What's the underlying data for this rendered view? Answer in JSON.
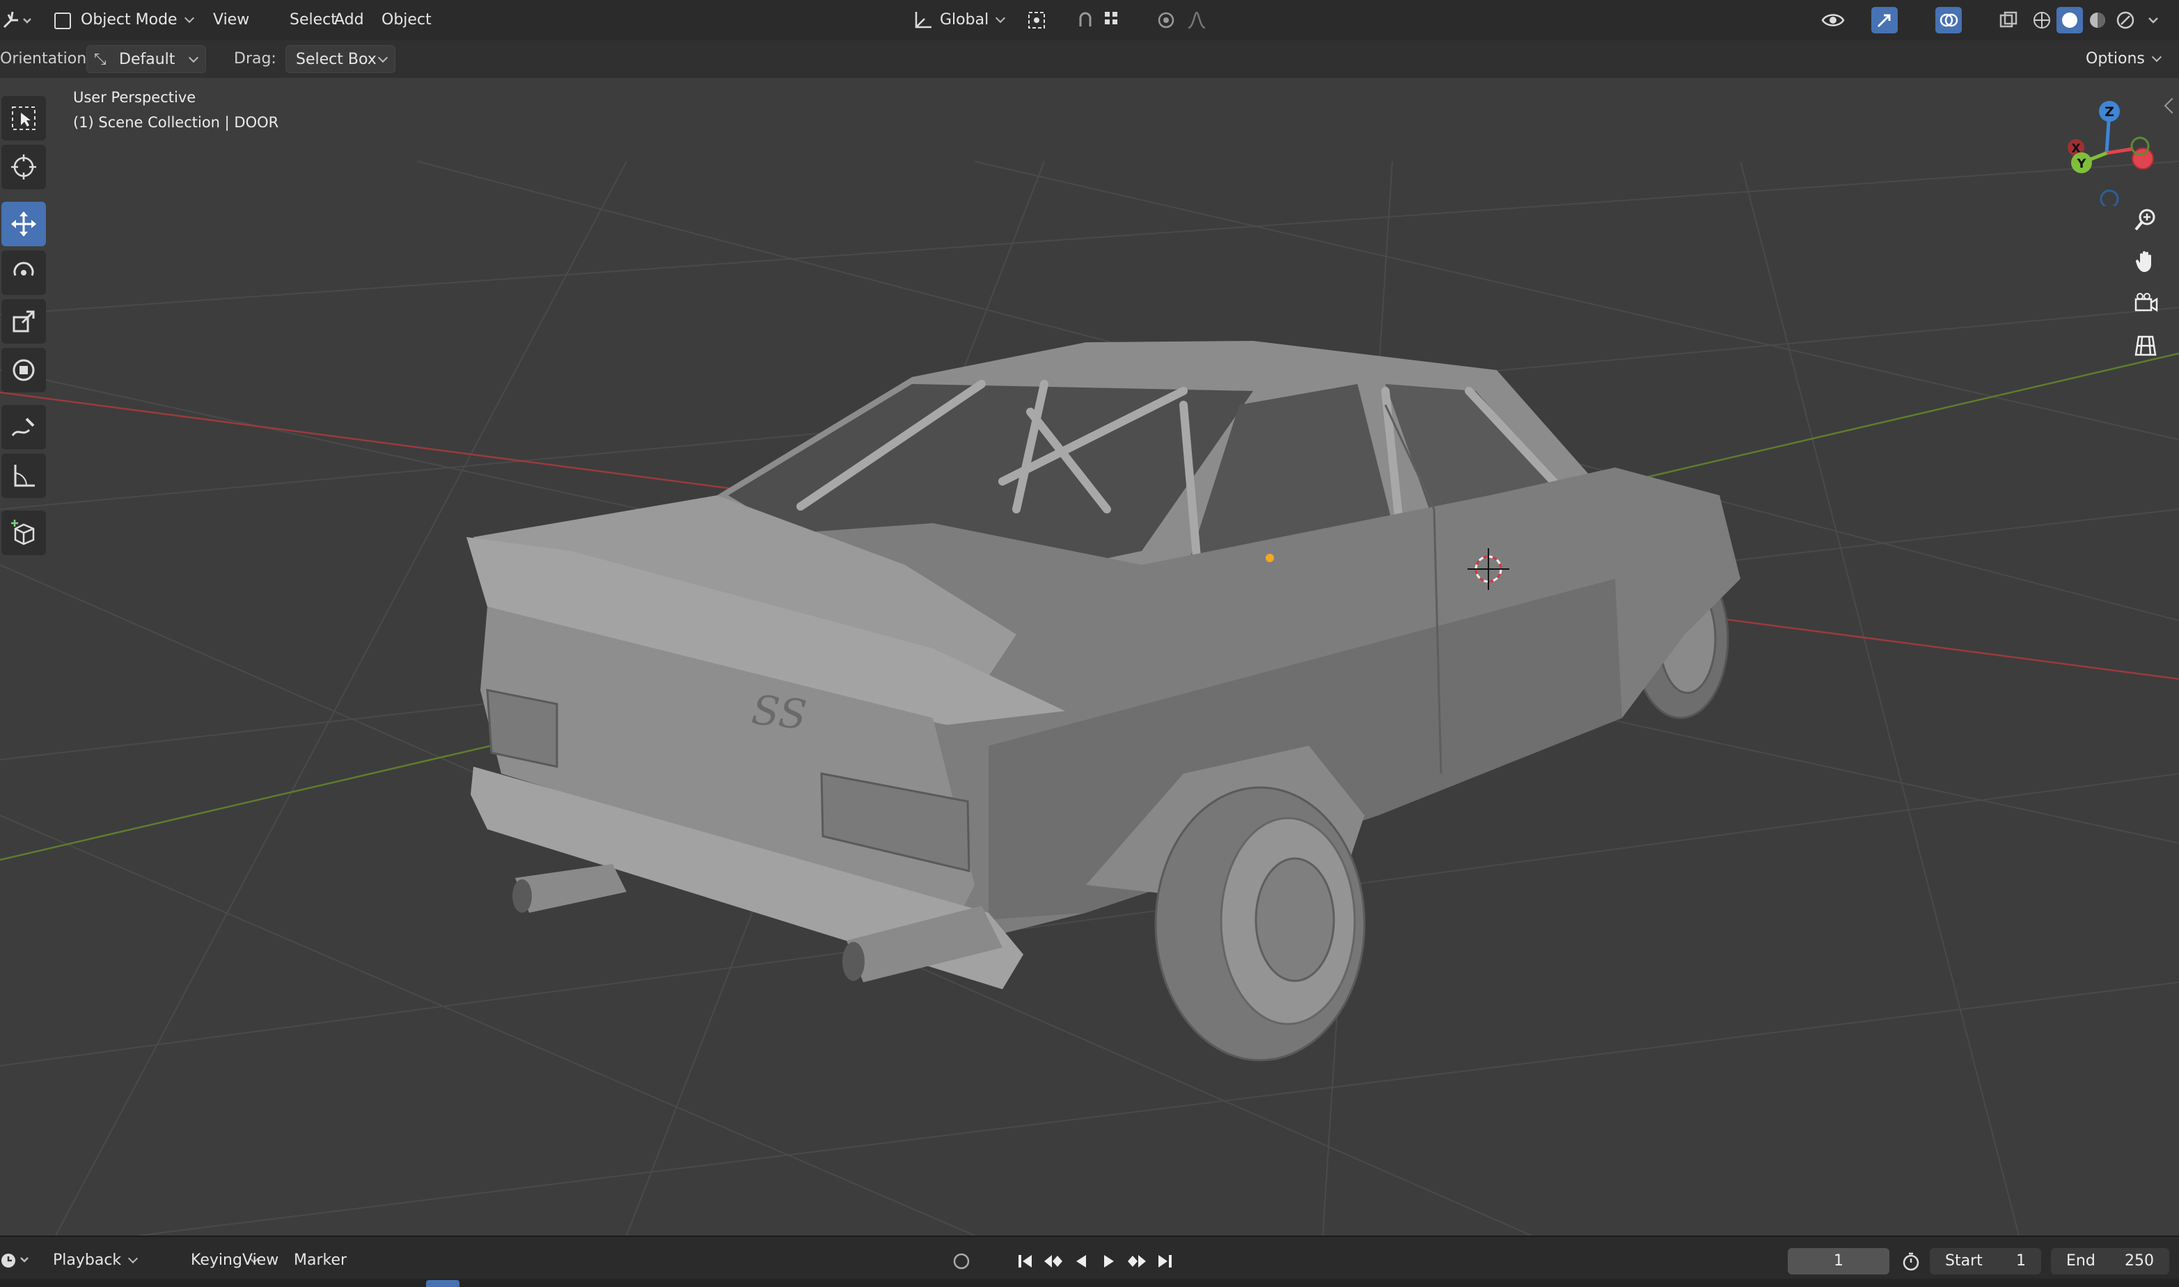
{
  "header": {
    "mode": "Object Mode",
    "menus": [
      "View",
      "Select",
      "Add",
      "Object"
    ],
    "transform_orientation": "Global",
    "icons": [
      "editor-type-icon",
      "pivot-icon",
      "snap-icon",
      "proportional-edit-icon",
      "visibility-icon",
      "gizmo-icon",
      "overlay-icon",
      "xray-icon",
      "wireframe-shading-icon",
      "solid-shading-icon",
      "material-shading-icon",
      "rendered-shading-icon"
    ]
  },
  "tool_header": {
    "orientation_label": "Orientation:",
    "orientation_value": "Default",
    "drag_label": "Drag:",
    "drag_value": "Select Box",
    "options_label": "Options"
  },
  "viewport": {
    "view_name": "User Perspective",
    "collection_info": "(1) Scene Collection | DOOR",
    "badge_text": "SS",
    "gizmo_axes": [
      "Z",
      "X",
      "Y"
    ]
  },
  "toolbar": {
    "tools": [
      "select-box-tool",
      "cursor-tool",
      "move-tool",
      "rotate-tool",
      "scale-tool",
      "transform-tool",
      "annotate-tool",
      "measure-tool",
      "add-cube-tool"
    ],
    "active": "move-tool"
  },
  "nav_buttons": [
    "zoom-icon",
    "hand-pan-icon",
    "camera-icon",
    "grid-ortho-icon"
  ],
  "timeline": {
    "menus": [
      "Playback",
      "Keying",
      "View",
      "Marker"
    ],
    "current_frame": "1",
    "start_label": "Start",
    "start_value": "1",
    "end_label": "End",
    "end_value": "250"
  },
  "colors": {
    "accent": "#4772b3",
    "x_axis": "#e0444e",
    "y_axis": "#7fbf3a",
    "z_axis": "#3f86d6",
    "viewport_bg": "#3d3d3d"
  }
}
